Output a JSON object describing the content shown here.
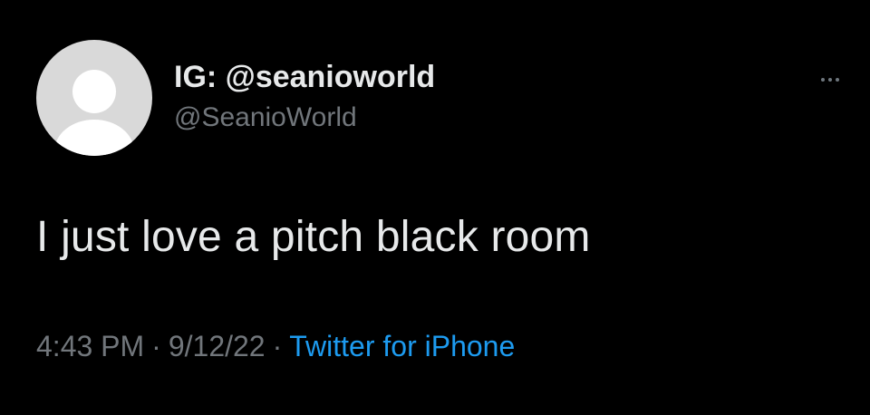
{
  "tweet": {
    "author": {
      "display_name": "IG: @seanioworld",
      "handle": "@SeanioWorld",
      "avatar_icon": "default-avatar-icon"
    },
    "more_icon": "ellipsis-icon",
    "text": "I just love a pitch black room",
    "time": "4:43 PM",
    "date": "9/12/22",
    "separator": "·",
    "source": "Twitter for iPhone"
  },
  "colors": {
    "background": "#000000",
    "primary_text": "#e7e9ea",
    "secondary_text": "#71767b",
    "link": "#1d9bf0",
    "avatar_bg": "#d9d9d9"
  }
}
